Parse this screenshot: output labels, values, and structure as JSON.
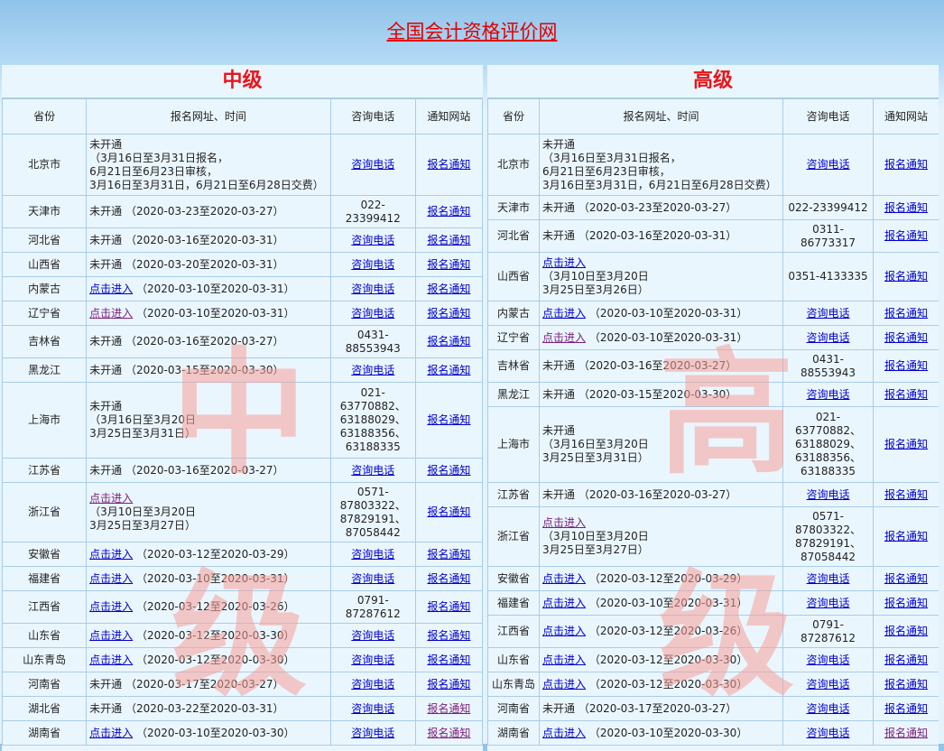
{
  "site_title": "全国会计资格评价网",
  "columns": {
    "province": "省份",
    "info": "报名网址、时间",
    "phone": "咨询电话",
    "notice": "通知网站"
  },
  "link_labels": {
    "enter": "点击进入",
    "phone": "咨询电话",
    "notice": "报名通知"
  },
  "colors": {
    "title_red": "#e8151b",
    "link_blue": "#0000cc",
    "border": "#a9cde6"
  },
  "intermediate": {
    "title": "中级",
    "watermark": [
      "中",
      "级"
    ],
    "rows": [
      {
        "province": "北京市",
        "info": [
          "未开通",
          "（3月16日至3月31日报名，",
          "6月21日至6月23日审核，",
          "3月16日至3月31日，6月21日至6月28日交费）"
        ],
        "phone_text": "",
        "phone_link": true
      },
      {
        "province": "天津市",
        "info": [
          "未开通 （2020-03-23至2020-03-27）"
        ],
        "phone_text": "022-\n23399412",
        "phone_link": false
      },
      {
        "province": "河北省",
        "info": [
          "未开通 （2020-03-16至2020-03-31）"
        ],
        "phone_text": "",
        "phone_link": true
      },
      {
        "province": "山西省",
        "info": [
          "未开通 （2020-03-20至2020-03-31）"
        ],
        "phone_text": "",
        "phone_link": true
      },
      {
        "province": "内蒙古",
        "enter": true,
        "info": [
          "（2020-03-10至2020-03-31）"
        ],
        "phone_text": "",
        "phone_link": true
      },
      {
        "province": "辽宁省",
        "enter": true,
        "enter_visited": true,
        "info": [
          "（2020-03-10至2020-03-31）"
        ],
        "phone_text": "",
        "phone_link": true
      },
      {
        "province": "吉林省",
        "info": [
          "未开通 （2020-03-16至2020-03-27）"
        ],
        "phone_text": "0431-\n88553943",
        "phone_link": false
      },
      {
        "province": "黑龙江",
        "info": [
          "未开通 （2020-03-15至2020-03-30）"
        ],
        "phone_text": "",
        "phone_link": true
      },
      {
        "province": "上海市",
        "info": [
          "未开通",
          "（3月16日至3月20日",
          "3月25日至3月31日）"
        ],
        "phone_text": "021-\n63770882、\n63188029、\n63188356、\n63188335",
        "phone_link": false
      },
      {
        "province": "江苏省",
        "info": [
          "未开通 （2020-03-16至2020-03-27）"
        ],
        "phone_text": "",
        "phone_link": true
      },
      {
        "province": "浙江省",
        "enter_block": true,
        "enter_visited": true,
        "info": [
          "（3月10日至3月20日",
          "3月25日至3月27日）"
        ],
        "phone_text": "0571-\n87803322、\n87829191、\n87058442",
        "phone_link": false
      },
      {
        "province": "安徽省",
        "enter": true,
        "info": [
          "（2020-03-12至2020-03-29）"
        ],
        "phone_text": "",
        "phone_link": true
      },
      {
        "province": "福建省",
        "enter": true,
        "info": [
          "（2020-03-10至2020-03-31）"
        ],
        "phone_text": "",
        "phone_link": true
      },
      {
        "province": "江西省",
        "enter": true,
        "info": [
          "（2020-03-12至2020-03-26）"
        ],
        "phone_text": "0791-\n87287612",
        "phone_link": false
      },
      {
        "province": "山东省",
        "enter": true,
        "info": [
          "（2020-03-12至2020-03-30）"
        ],
        "phone_text": "",
        "phone_link": true
      },
      {
        "province": "山东青岛",
        "enter": true,
        "info": [
          "（2020-03-12至2020-03-30）"
        ],
        "phone_text": "",
        "phone_link": true
      },
      {
        "province": "河南省",
        "info": [
          "未开通 （2020-03-17至2020-03-27）"
        ],
        "phone_text": "",
        "phone_link": true
      },
      {
        "province": "湖北省",
        "info": [
          "未开通 （2020-03-22至2020-03-31）"
        ],
        "phone_text": "",
        "phone_link": true,
        "notice_visited": true
      },
      {
        "province": "湖南省",
        "enter": true,
        "info": [
          "（2020-03-10至2020-03-30）"
        ],
        "phone_text": "",
        "phone_link": true,
        "notice_visited": true
      }
    ]
  },
  "senior": {
    "title": "高级",
    "watermark": [
      "高",
      "级"
    ],
    "rows": [
      {
        "province": "北京市",
        "info": [
          "未开通",
          "（3月16日至3月31日报名，",
          "6月21日至6月23日审核，",
          "3月16日至3月31日，6月21日至6月28日交费）"
        ],
        "phone_text": "",
        "phone_link": true
      },
      {
        "province": "天津市",
        "info": [
          "未开通 （2020-03-23至2020-03-27）"
        ],
        "phone_text": "022-23399412",
        "phone_link": false
      },
      {
        "province": "河北省",
        "info": [
          "未开通 （2020-03-16至2020-03-31）"
        ],
        "phone_text": "0311-\n86773317",
        "phone_link": false
      },
      {
        "province": "山西省",
        "enter_block": true,
        "info": [
          "（3月10日至3月20日",
          "3月25日至3月26日）"
        ],
        "phone_text": "0351-4133335",
        "phone_link": false
      },
      {
        "province": "内蒙古",
        "enter": true,
        "info": [
          "（2020-03-10至2020-03-31）"
        ],
        "phone_text": "",
        "phone_link": true
      },
      {
        "province": "辽宁省",
        "enter": true,
        "enter_visited": true,
        "info": [
          "（2020-03-10至2020-03-31）"
        ],
        "phone_text": "",
        "phone_link": true
      },
      {
        "province": "吉林省",
        "info": [
          "未开通 （2020-03-16至2020-03-27）"
        ],
        "phone_text": "0431-\n88553943",
        "phone_link": false
      },
      {
        "province": "黑龙江",
        "info": [
          "未开通 （2020-03-15至2020-03-30）"
        ],
        "phone_text": "",
        "phone_link": true
      },
      {
        "province": "上海市",
        "info": [
          "未开通",
          "（3月16日至3月20日",
          "3月25日至3月31日）"
        ],
        "phone_text": "021-\n63770882、\n63188029、\n63188356、\n63188335",
        "phone_link": false
      },
      {
        "province": "江苏省",
        "info": [
          "未开通 （2020-03-16至2020-03-27）"
        ],
        "phone_text": "",
        "phone_link": true
      },
      {
        "province": "浙江省",
        "enter_block": true,
        "enter_visited": true,
        "info": [
          "（3月10日至3月20日",
          "3月25日至3月27日）"
        ],
        "phone_text": "0571-\n87803322、\n87829191、\n87058442",
        "phone_link": false
      },
      {
        "province": "安徽省",
        "enter": true,
        "info": [
          "（2020-03-12至2020-03-29）"
        ],
        "phone_text": "",
        "phone_link": true
      },
      {
        "province": "福建省",
        "enter": true,
        "info": [
          "（2020-03-10至2020-03-31）"
        ],
        "phone_text": "",
        "phone_link": true
      },
      {
        "province": "江西省",
        "enter": true,
        "info": [
          "（2020-03-12至2020-03-26）"
        ],
        "phone_text": "0791-\n87287612",
        "phone_link": false
      },
      {
        "province": "山东省",
        "enter": true,
        "info": [
          "（2020-03-12至2020-03-30）"
        ],
        "phone_text": "",
        "phone_link": true
      },
      {
        "province": "山东青岛",
        "enter": true,
        "info": [
          "（2020-03-12至2020-03-30）"
        ],
        "phone_text": "",
        "phone_link": true
      },
      {
        "province": "河南省",
        "info": [
          "未开通 （2020-03-17至2020-03-27）"
        ],
        "phone_text": "",
        "phone_link": true
      },
      {
        "province": "湖南省",
        "enter": true,
        "info": [
          "（2020-03-10至2020-03-30）"
        ],
        "phone_text": "",
        "phone_link": true,
        "notice_visited": true
      }
    ]
  }
}
